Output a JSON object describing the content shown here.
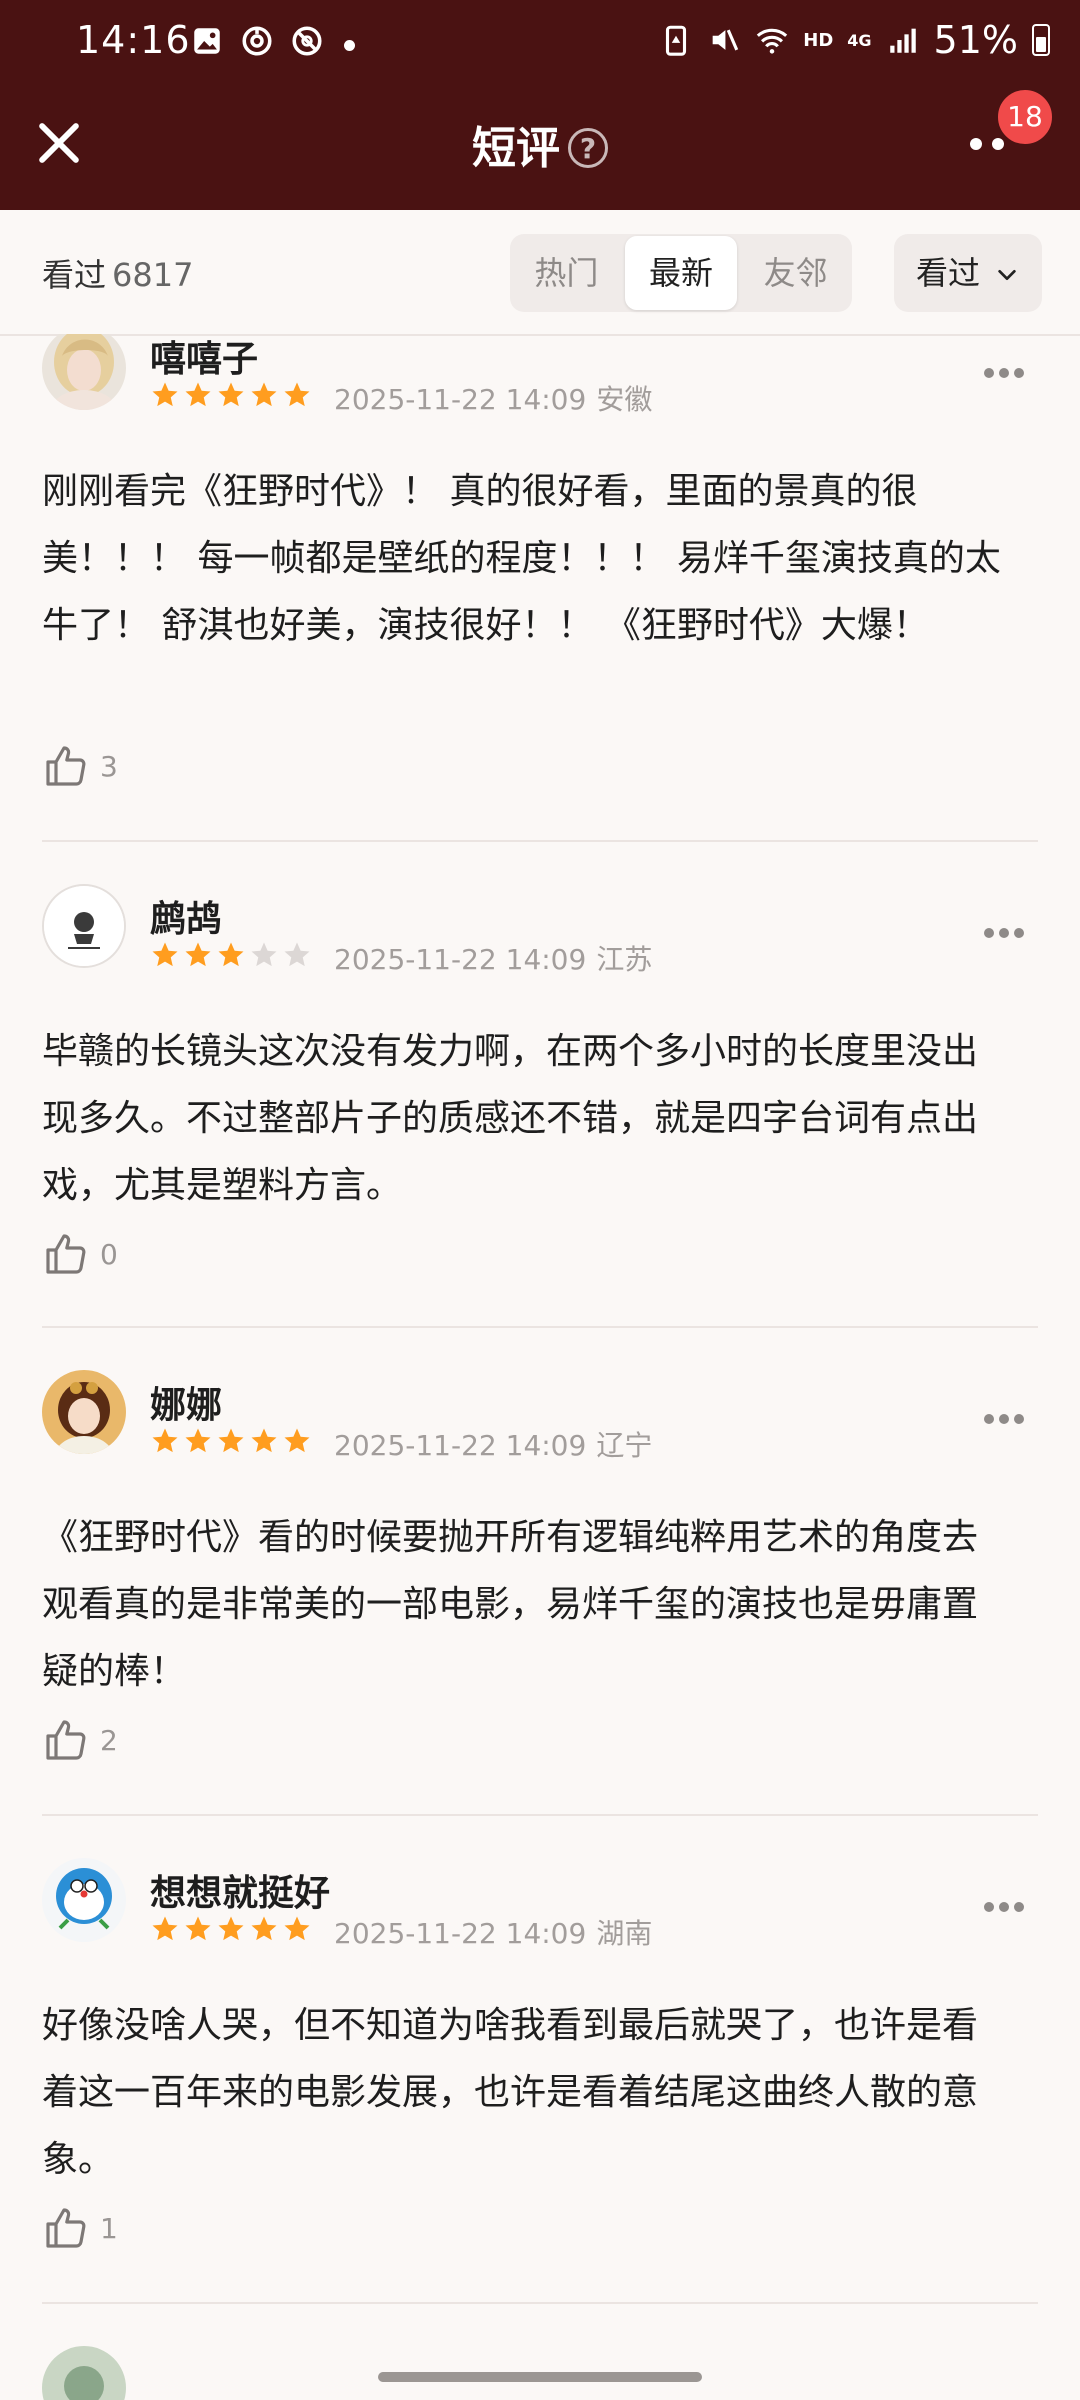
{
  "status_bar": {
    "time": "14:16",
    "network_hd": "HD",
    "network_gen": "4G",
    "battery": "51%",
    "icons": [
      "image-icon",
      "sync-icon",
      "block-icon",
      "dot-icon",
      "save-battery-icon",
      "mute-icon",
      "wifi-icon",
      "signal-icon",
      "battery-icon"
    ]
  },
  "header": {
    "title": "短评",
    "help": "?",
    "badge": "18",
    "icons": [
      "close-icon",
      "help-icon",
      "more-icon"
    ]
  },
  "filter": {
    "count_label": "看过",
    "count_value": "6817",
    "tabs": [
      "热门",
      "最新",
      "友邻"
    ],
    "active_tab": "最新",
    "dropdown_label": "看过"
  },
  "reviews": [
    {
      "name": "嘻嘻子",
      "rating": 5,
      "date": "2025-11-22 14:09",
      "location": "安徽",
      "text": "刚刚看完《狂野时代》！ 真的很好看，里面的景真的很美！！！ 每一帧都是壁纸的程度！！！ 易烊千玺演技真的太牛了！ 舒淇也好美，演技很好！！ 《狂野时代》大爆！",
      "likes": "3"
    },
    {
      "name": "鹧鸪",
      "rating": 3,
      "date": "2025-11-22 14:09",
      "location": "江苏",
      "text": "毕赣的长镜头这次没有发力啊，在两个多小时的长度里没出现多久。不过整部片子的质感还不错，就是四字台词有点出戏，尤其是塑料方言。",
      "likes": "0"
    },
    {
      "name": "娜娜",
      "rating": 5,
      "date": "2025-11-22 14:09",
      "location": "辽宁",
      "text": "《狂野时代》看的时候要抛开所有逻辑纯粹用艺术的角度去观看真的是非常美的一部电影，易烊千玺的演技也是毋庸置疑的棒！",
      "likes": "2"
    },
    {
      "name": "想想就挺好",
      "rating": 5,
      "date": "2025-11-22 14:09",
      "location": "湖南",
      "text": "好像没啥人哭，但不知道为啥我看到最后就哭了，也许是看着这一百年来的电影发展，也许是看着结尾这曲终人散的意象。",
      "likes": "1"
    }
  ],
  "colors": {
    "header_bg": "#4a1212",
    "star_on": "#ff9d1f",
    "star_off": "#dcd7d5",
    "badge": "#f04a4a"
  }
}
